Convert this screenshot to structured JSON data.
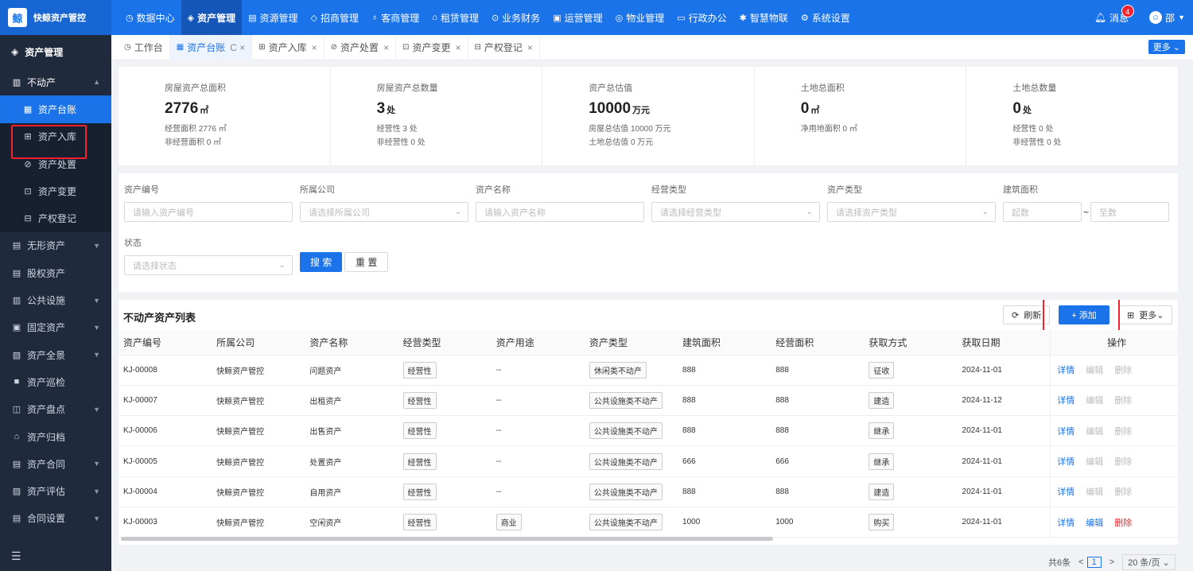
{
  "brand": {
    "name": "快鲸资产管控",
    "logo": "鲸"
  },
  "topnav": [
    {
      "icon": "◷",
      "label": "数据中心"
    },
    {
      "icon": "◈",
      "label": "资产管理",
      "active": true
    },
    {
      "icon": "▤",
      "label": "资源管理"
    },
    {
      "icon": "◇",
      "label": "招商管理"
    },
    {
      "icon": "♁",
      "label": "客商管理"
    },
    {
      "icon": "⌂",
      "label": "租赁管理"
    },
    {
      "icon": "⊙",
      "label": "业务财务"
    },
    {
      "icon": "▣",
      "label": "运营管理"
    },
    {
      "icon": "◎",
      "label": "物业管理"
    },
    {
      "icon": "▭",
      "label": "行政办公"
    },
    {
      "icon": "✱",
      "label": "智慧物联"
    },
    {
      "icon": "⚙",
      "label": "系统设置"
    }
  ],
  "top_right": {
    "messages_label": "消息",
    "messages_count": "4",
    "user_name": "邵",
    "user_avatar": "☺"
  },
  "sidebar": {
    "header": "资产管理",
    "items": [
      {
        "icon": "▥",
        "label": "不动产",
        "arrow": "▲",
        "open": true
      },
      {
        "icon": "▦",
        "label": "资产台账",
        "sub": true,
        "active": true
      },
      {
        "icon": "⊞",
        "label": "资产入库",
        "sub": true
      },
      {
        "icon": "⊘",
        "label": "资产处置",
        "sub": true
      },
      {
        "icon": "⊡",
        "label": "资产变更",
        "sub": true
      },
      {
        "icon": "⊟",
        "label": "产权登记",
        "sub": true
      },
      {
        "icon": "▤",
        "label": "无形资产",
        "arrow": "▼"
      },
      {
        "icon": "▤",
        "label": "股权资产"
      },
      {
        "icon": "▥",
        "label": "公共设施",
        "arrow": "▼"
      },
      {
        "icon": "▣",
        "label": "固定资产",
        "arrow": "▼"
      },
      {
        "icon": "▧",
        "label": "资产全景",
        "arrow": "▼"
      },
      {
        "icon": "■",
        "label": "资产巡检"
      },
      {
        "icon": "◫",
        "label": "资产盘点",
        "arrow": "▼"
      },
      {
        "icon": "⌂",
        "label": "资产归档"
      },
      {
        "icon": "▤",
        "label": "资产合同",
        "arrow": "▼"
      },
      {
        "icon": "▨",
        "label": "资产评估",
        "arrow": "▼"
      },
      {
        "icon": "▤",
        "label": "合同设置",
        "arrow": "▼"
      }
    ],
    "collapse_icon": "☰"
  },
  "tabs": [
    {
      "icon": "◷",
      "label": "工作台"
    },
    {
      "icon": "▦",
      "label": "资产台账",
      "active": true,
      "close": "C ×"
    },
    {
      "icon": "⊞",
      "label": "资产入库",
      "close": "×"
    },
    {
      "icon": "⊘",
      "label": "资产处置",
      "close": "×"
    },
    {
      "icon": "⊡",
      "label": "资产变更",
      "close": "×"
    },
    {
      "icon": "⊟",
      "label": "产权登记",
      "close": "×"
    }
  ],
  "tabs_more": "更多 ⌄",
  "stats": [
    {
      "title": "房屋资产总面积",
      "value": "2776",
      "unit": "㎡",
      "subs": [
        "经营面积 2776 ㎡",
        "非经营面积 0 ㎡"
      ]
    },
    {
      "title": "房屋资产总数量",
      "value": "3",
      "unit": "处",
      "subs": [
        "经营性 3 处",
        "非经营性 0 处"
      ]
    },
    {
      "title": "资产总估值",
      "value": "10000",
      "unit": "万元",
      "subs": [
        "房屋总估值 10000 万元",
        "土地总估值 0 万元"
      ]
    },
    {
      "title": "土地总面积",
      "value": "0",
      "unit": "㎡",
      "subs": [
        "净用地面积 0 ㎡"
      ]
    },
    {
      "title": "土地总数量",
      "value": "0",
      "unit": "处",
      "subs": [
        "经营性 0 处",
        "非经营性 0 处"
      ]
    }
  ],
  "filters": {
    "asset_no": {
      "label": "资产编号",
      "placeholder": "请输入资产编号"
    },
    "company": {
      "label": "所属公司",
      "placeholder": "请选择所属公司"
    },
    "asset_name": {
      "label": "资产名称",
      "placeholder": "请输入资产名称"
    },
    "biz_type": {
      "label": "经营类型",
      "placeholder": "请选择经营类型"
    },
    "asset_type": {
      "label": "资产类型",
      "placeholder": "请选择资产类型"
    },
    "area": {
      "label": "建筑面积",
      "from": "起数",
      "sep": "~",
      "to": "至数"
    },
    "status": {
      "label": "状态",
      "placeholder": "请选择状态"
    },
    "search": "搜 索",
    "reset": "重 置"
  },
  "table": {
    "title": "不动产资产列表",
    "refresh": "刷新",
    "add": "+ 添加",
    "more": "更多⌄",
    "columns": [
      "资产编号",
      "所属公司",
      "资产名称",
      "经营类型",
      "资产用途",
      "资产类型",
      "建筑面积",
      "经营面积",
      "获取方式",
      "获取日期",
      "操作"
    ],
    "rows": [
      {
        "no": "KJ-00008",
        "company": "快鲸资产管控",
        "name": "问题资产",
        "biz": "经营性",
        "use": "--",
        "type": "休闲类不动产",
        "area": "888",
        "biz_area": "888",
        "method": "征收",
        "date": "2024-11-01",
        "ops": [
          "详情",
          "编辑",
          "删除"
        ],
        "active": false
      },
      {
        "no": "KJ-00007",
        "company": "快鲸资产管控",
        "name": "出租资产",
        "biz": "经营性",
        "use": "--",
        "type": "公共设施类不动产",
        "area": "888",
        "biz_area": "888",
        "method": "建造",
        "date": "2024-11-12",
        "ops": [
          "详情",
          "编辑",
          "删除"
        ],
        "active": false
      },
      {
        "no": "KJ-00006",
        "company": "快鲸资产管控",
        "name": "出售资产",
        "biz": "经营性",
        "use": "--",
        "type": "公共设施类不动产",
        "area": "888",
        "biz_area": "888",
        "method": "继承",
        "date": "2024-11-01",
        "ops": [
          "详情",
          "编辑",
          "删除"
        ],
        "active": false
      },
      {
        "no": "KJ-00005",
        "company": "快鲸资产管控",
        "name": "处置资产",
        "biz": "经营性",
        "use": "--",
        "type": "公共设施类不动产",
        "area": "666",
        "biz_area": "666",
        "method": "继承",
        "date": "2024-11-01",
        "ops": [
          "详情",
          "编辑",
          "删除"
        ],
        "active": false
      },
      {
        "no": "KJ-00004",
        "company": "快鲸资产管控",
        "name": "自用资产",
        "biz": "经营性",
        "use": "--",
        "type": "公共设施类不动产",
        "area": "888",
        "biz_area": "888",
        "method": "建造",
        "date": "2024-11-01",
        "ops": [
          "详情",
          "编辑",
          "删除"
        ],
        "active": false
      },
      {
        "no": "KJ-00003",
        "company": "快鲸资产管控",
        "name": "空闲资产",
        "biz": "经营性",
        "use": "商业",
        "type": "公共设施类不动产",
        "area": "1000",
        "biz_area": "1000",
        "method": "购买",
        "date": "2024-11-01",
        "ops": [
          "详情",
          "编辑",
          "删除"
        ],
        "active": true
      }
    ]
  },
  "pagination": {
    "total": "共6条",
    "prev": "<",
    "page": "1",
    "next": ">",
    "size": "20 条/页 ⌄"
  }
}
